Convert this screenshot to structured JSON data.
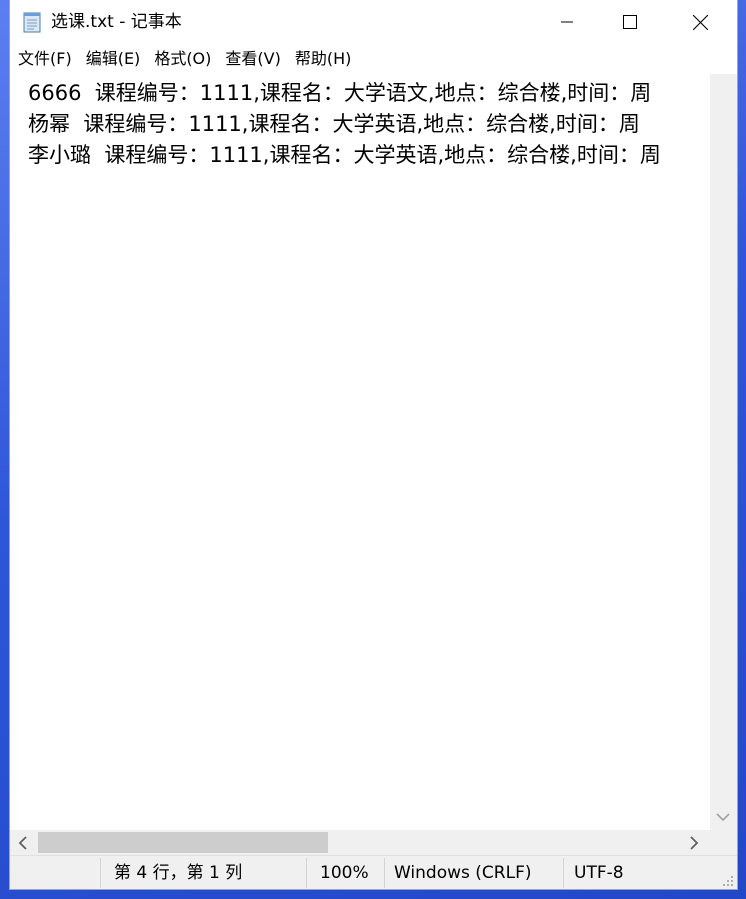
{
  "window": {
    "title": "选课.txt - 记事本",
    "app_icon": "notepad-icon",
    "controls": {
      "minimize": "minimize-icon",
      "maximize": "maximize-icon",
      "close": "close-icon"
    }
  },
  "menu": [
    {
      "label": "文件(F)"
    },
    {
      "label": "编辑(E)"
    },
    {
      "label": "格式(O)"
    },
    {
      "label": "查看(V)"
    },
    {
      "label": "帮助(H)"
    }
  ],
  "editor": {
    "lines": [
      "6666  课程编号：1111,课程名：大学语文,地点：综合楼,时间：周",
      "杨幂  课程编号：1111,课程名：大学英语,地点：综合楼,时间：周",
      "李小璐  课程编号：1111,课程名：大学英语,地点：综合楼,时间：周"
    ]
  },
  "statusbar": {
    "position": "第 4 行，第 1 列",
    "zoom": "100%",
    "line_ending": "Windows (CRLF)",
    "encoding": "UTF-8"
  },
  "colors": {
    "desktop": "#2f56d8",
    "scroll_thumb": "#cdcdcd",
    "status_bg": "#f0f0f0"
  }
}
